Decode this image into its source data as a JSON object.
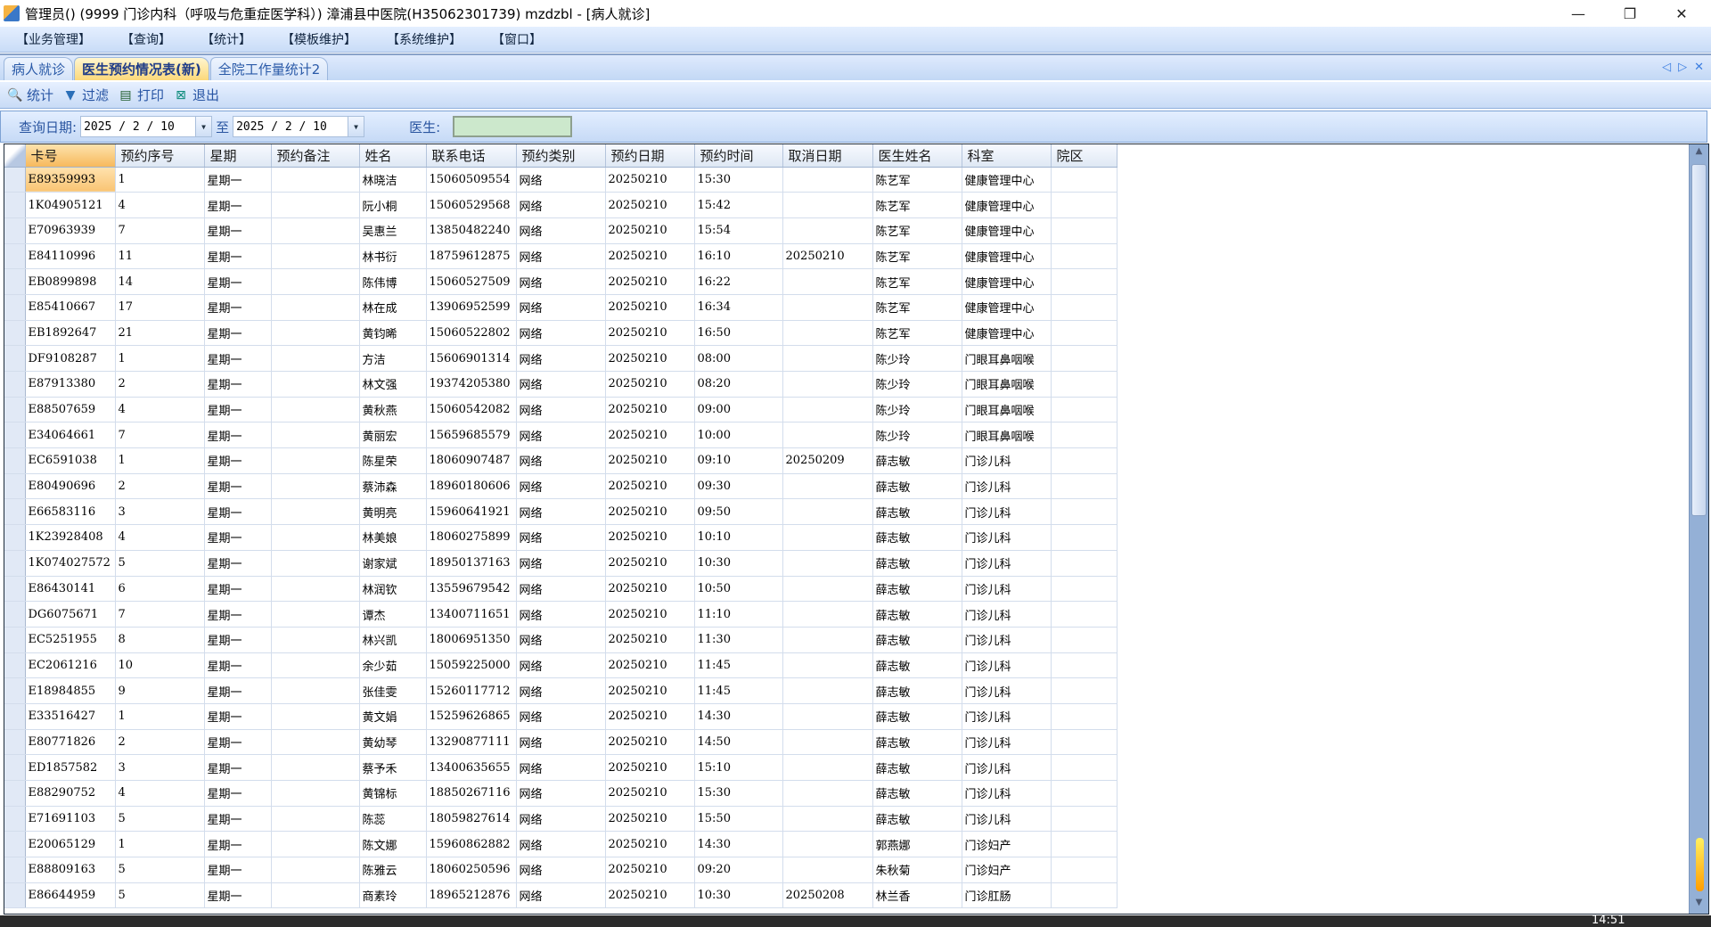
{
  "window": {
    "title": "管理员() (9999 门诊内科（呼吸与危重症医学科）) 漳浦县中医院(H35062301739) mzdzbl - [病人就诊]",
    "minimize": "—",
    "restore": "❐",
    "close": "✕"
  },
  "menu": [
    "【业务管理】",
    "【查询】",
    "【统计】",
    "【模板维护】",
    "【系统维护】",
    "【窗口】"
  ],
  "tabs": [
    {
      "label": "病人就诊",
      "active": false
    },
    {
      "label": "医生预约情况表(新)",
      "active": true
    },
    {
      "label": "全院工作量统计2",
      "active": false
    }
  ],
  "tab_controls": {
    "prev": "◁",
    "next": "▷",
    "close": "✕"
  },
  "toolbar": [
    {
      "label": "统计",
      "icon": "magnifier-icon"
    },
    {
      "label": "过滤",
      "icon": "filter-icon"
    },
    {
      "label": "打印",
      "icon": "printer-icon"
    },
    {
      "label": "退出",
      "icon": "exit-icon"
    }
  ],
  "query": {
    "date_label": "查询日期:",
    "from": "2025 / 2 / 10",
    "to_label": "至",
    "to": "2025 / 2 / 10",
    "doctor_label": "医生:",
    "doctor_value": ""
  },
  "grid": {
    "columns": [
      "卡号",
      "预约序号",
      "星期",
      "预约备注",
      "姓名",
      "联系电话",
      "预约类别",
      "预约日期",
      "预约时间",
      "取消日期",
      "医生姓名",
      "科室",
      "院区"
    ],
    "rows": [
      [
        "E89359993",
        "1",
        "星期一",
        "",
        "林晓洁",
        "15060509554",
        "网络",
        "20250210",
        "15:30",
        "",
        "陈艺军",
        "健康管理中心",
        ""
      ],
      [
        "1K04905121",
        "4",
        "星期一",
        "",
        "阮小桐",
        "15060529568",
        "网络",
        "20250210",
        "15:42",
        "",
        "陈艺军",
        "健康管理中心",
        ""
      ],
      [
        "E70963939",
        "7",
        "星期一",
        "",
        "吴惠兰",
        "13850482240",
        "网络",
        "20250210",
        "15:54",
        "",
        "陈艺军",
        "健康管理中心",
        ""
      ],
      [
        "E84110996",
        "11",
        "星期一",
        "",
        "林书衍",
        "18759612875",
        "网络",
        "20250210",
        "16:10",
        "20250210",
        "陈艺军",
        "健康管理中心",
        ""
      ],
      [
        "EB0899898",
        "14",
        "星期一",
        "",
        "陈伟博",
        "15060527509",
        "网络",
        "20250210",
        "16:22",
        "",
        "陈艺军",
        "健康管理中心",
        ""
      ],
      [
        "E85410667",
        "17",
        "星期一",
        "",
        "林在成",
        "13906952599",
        "网络",
        "20250210",
        "16:34",
        "",
        "陈艺军",
        "健康管理中心",
        ""
      ],
      [
        "EB1892647",
        "21",
        "星期一",
        "",
        "黄钧晞",
        "15060522802",
        "网络",
        "20250210",
        "16:50",
        "",
        "陈艺军",
        "健康管理中心",
        ""
      ],
      [
        "DF9108287",
        "1",
        "星期一",
        "",
        "方洁",
        "15606901314",
        "网络",
        "20250210",
        "08:00",
        "",
        "陈少玲",
        "门眼耳鼻咽喉",
        ""
      ],
      [
        "E87913380",
        "2",
        "星期一",
        "",
        "林文强",
        "19374205380",
        "网络",
        "20250210",
        "08:20",
        "",
        "陈少玲",
        "门眼耳鼻咽喉",
        ""
      ],
      [
        "E88507659",
        "4",
        "星期一",
        "",
        "黄秋燕",
        "15060542082",
        "网络",
        "20250210",
        "09:00",
        "",
        "陈少玲",
        "门眼耳鼻咽喉",
        ""
      ],
      [
        "E34064661",
        "7",
        "星期一",
        "",
        "黄丽宏",
        "15659685579",
        "网络",
        "20250210",
        "10:00",
        "",
        "陈少玲",
        "门眼耳鼻咽喉",
        ""
      ],
      [
        "EC6591038",
        "1",
        "星期一",
        "",
        "陈星荣",
        "18060907487",
        "网络",
        "20250210",
        "09:10",
        "20250209",
        "薛志敏",
        "门诊儿科",
        ""
      ],
      [
        "E80490696",
        "2",
        "星期一",
        "",
        "蔡沛森",
        "18960180606",
        "网络",
        "20250210",
        "09:30",
        "",
        "薛志敏",
        "门诊儿科",
        ""
      ],
      [
        "E66583116",
        "3",
        "星期一",
        "",
        "黄明亮",
        "15960641921",
        "网络",
        "20250210",
        "09:50",
        "",
        "薛志敏",
        "门诊儿科",
        ""
      ],
      [
        "1K23928408",
        "4",
        "星期一",
        "",
        "林美娘",
        "18060275899",
        "网络",
        "20250210",
        "10:10",
        "",
        "薛志敏",
        "门诊儿科",
        ""
      ],
      [
        "1K074027572",
        "5",
        "星期一",
        "",
        "谢家斌",
        "18950137163",
        "网络",
        "20250210",
        "10:30",
        "",
        "薛志敏",
        "门诊儿科",
        ""
      ],
      [
        "E86430141",
        "6",
        "星期一",
        "",
        "林润钦",
        "13559679542",
        "网络",
        "20250210",
        "10:50",
        "",
        "薛志敏",
        "门诊儿科",
        ""
      ],
      [
        "DG6075671",
        "7",
        "星期一",
        "",
        "谭杰",
        "13400711651",
        "网络",
        "20250210",
        "11:10",
        "",
        "薛志敏",
        "门诊儿科",
        ""
      ],
      [
        "EC5251955",
        "8",
        "星期一",
        "",
        "林兴凯",
        "18006951350",
        "网络",
        "20250210",
        "11:30",
        "",
        "薛志敏",
        "门诊儿科",
        ""
      ],
      [
        "EC2061216",
        "10",
        "星期一",
        "",
        "余少茹",
        "15059225000",
        "网络",
        "20250210",
        "11:45",
        "",
        "薛志敏",
        "门诊儿科",
        ""
      ],
      [
        "E18984855",
        "9",
        "星期一",
        "",
        "张佳雯",
        "15260117712",
        "网络",
        "20250210",
        "11:45",
        "",
        "薛志敏",
        "门诊儿科",
        ""
      ],
      [
        "E33516427",
        "1",
        "星期一",
        "",
        "黄文娟",
        "15259626865",
        "网络",
        "20250210",
        "14:30",
        "",
        "薛志敏",
        "门诊儿科",
        ""
      ],
      [
        "E80771826",
        "2",
        "星期一",
        "",
        "黄幼琴",
        "13290877111",
        "网络",
        "20250210",
        "14:50",
        "",
        "薛志敏",
        "门诊儿科",
        ""
      ],
      [
        "ED1857582",
        "3",
        "星期一",
        "",
        "蔡予禾",
        "13400635655",
        "网络",
        "20250210",
        "15:10",
        "",
        "薛志敏",
        "门诊儿科",
        ""
      ],
      [
        "E88290752",
        "4",
        "星期一",
        "",
        "黄锦标",
        "18850267116",
        "网络",
        "20250210",
        "15:30",
        "",
        "薛志敏",
        "门诊儿科",
        ""
      ],
      [
        "E71691103",
        "5",
        "星期一",
        "",
        "陈蕊",
        "18059827614",
        "网络",
        "20250210",
        "15:50",
        "",
        "薛志敏",
        "门诊儿科",
        ""
      ],
      [
        "E20065129",
        "1",
        "星期一",
        "",
        "陈文娜",
        "15960862882",
        "网络",
        "20250210",
        "14:30",
        "",
        "郭燕娜",
        "门诊妇产",
        ""
      ],
      [
        "E88809163",
        "5",
        "星期一",
        "",
        "陈雅云",
        "18060250596",
        "网络",
        "20250210",
        "09:20",
        "",
        "朱秋菊",
        "门诊妇产",
        ""
      ],
      [
        "E86644959",
        "5",
        "星期一",
        "",
        "商素玲",
        "18965212876",
        "网络",
        "20250210",
        "10:30",
        "20250208",
        "林兰香",
        "门诊肛肠",
        ""
      ]
    ]
  },
  "taskbar": {
    "clock": "14:51"
  },
  "colors": {
    "selected_cell": "#f9c474",
    "menu_bg": "#c9dcf7",
    "doctor_input_bg": "#cce8cc"
  }
}
